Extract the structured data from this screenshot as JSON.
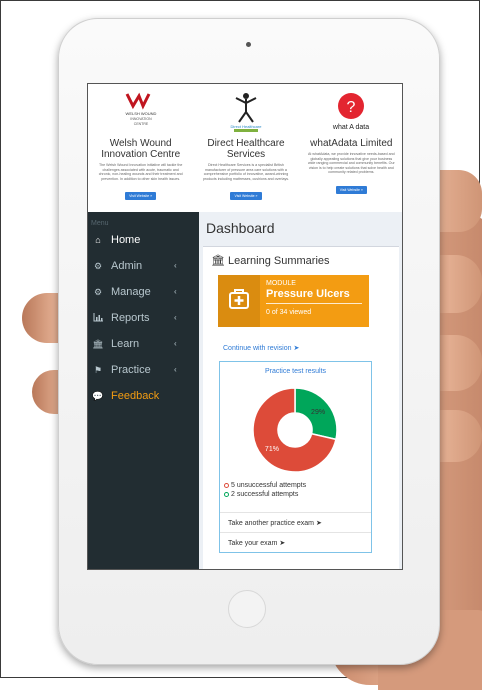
{
  "sponsors": [
    {
      "logo_caption": "WELSH WOUND INNOVATION CENTRE CANOLFAN ARLOESI CLWYFAU CYMRU",
      "title": "Welsh Wound Innovation Centre",
      "text": "The Welsh Wound Innovation initiative will tackle the challenges associated with acute, traumatic and chronic, non-healing wounds and their treatment and prevention. In addition to other skin health issues.",
      "button": "Visit Website »"
    },
    {
      "logo_caption": "Direct Healthcare Services",
      "title": "Direct Healthcare Services",
      "text": "Direct Healthcare Services is a specialist British manufacturer of pressure area care solutions with a comprehensive portfolio of innovative, award-winning products including mattresses, cushions and overlays.",
      "button": "Visit Website »"
    },
    {
      "logo_caption": "whatAdata",
      "title": "whatAdata Limited",
      "text": "At whatAdata, we provide innovative needs-based and globally appealing solutions that give your business wide ranging commercial and community benefits. Our vision is to help create solutions that solve health and community related problems.",
      "button": "Visit Website »"
    }
  ],
  "sidebar": {
    "menu_label": "Menu",
    "items": [
      {
        "label": "Home",
        "icon": "home-icon",
        "caret": ""
      },
      {
        "label": "Admin",
        "icon": "gear-icon",
        "caret": "‹"
      },
      {
        "label": "Manage",
        "icon": "gears-icon",
        "caret": "‹"
      },
      {
        "label": "Reports",
        "icon": "bar-chart-icon",
        "caret": "‹"
      },
      {
        "label": "Learn",
        "icon": "institution-icon",
        "caret": "‹"
      },
      {
        "label": "Practice",
        "icon": "graduation-cap-icon",
        "caret": "‹"
      },
      {
        "label": "Feedback",
        "icon": "comments-icon",
        "caret": ""
      }
    ]
  },
  "main": {
    "title": "Dashboard",
    "section_title": "Learning Summaries",
    "module": {
      "label": "MODULE",
      "name": "Pressure Ulcers",
      "viewed": "0 of 34 viewed",
      "progress": 0
    },
    "revision_link": "Continue with revision",
    "practice": {
      "title": "Practice test results",
      "unsuccessful_count": "5",
      "unsuccessful_label": "unsuccessful attempts",
      "successful_count": "2",
      "successful_label": "successful attempts",
      "actions": [
        "Take another practice exam",
        "Take your exam"
      ]
    }
  },
  "chart_data": {
    "type": "pie",
    "categories": [
      "unsuccessful attempts",
      "successful attempts"
    ],
    "values": [
      5,
      2
    ],
    "data_labels": [
      "71%",
      "29%"
    ],
    "colors": [
      "#dd4b39",
      "#00a65a"
    ]
  },
  "colors": {
    "sidebar_bg": "#222d32",
    "accent_orange": "#f39c12",
    "link_blue": "#2f7bd6",
    "danger": "#dd4b39",
    "success": "#00a65a"
  }
}
